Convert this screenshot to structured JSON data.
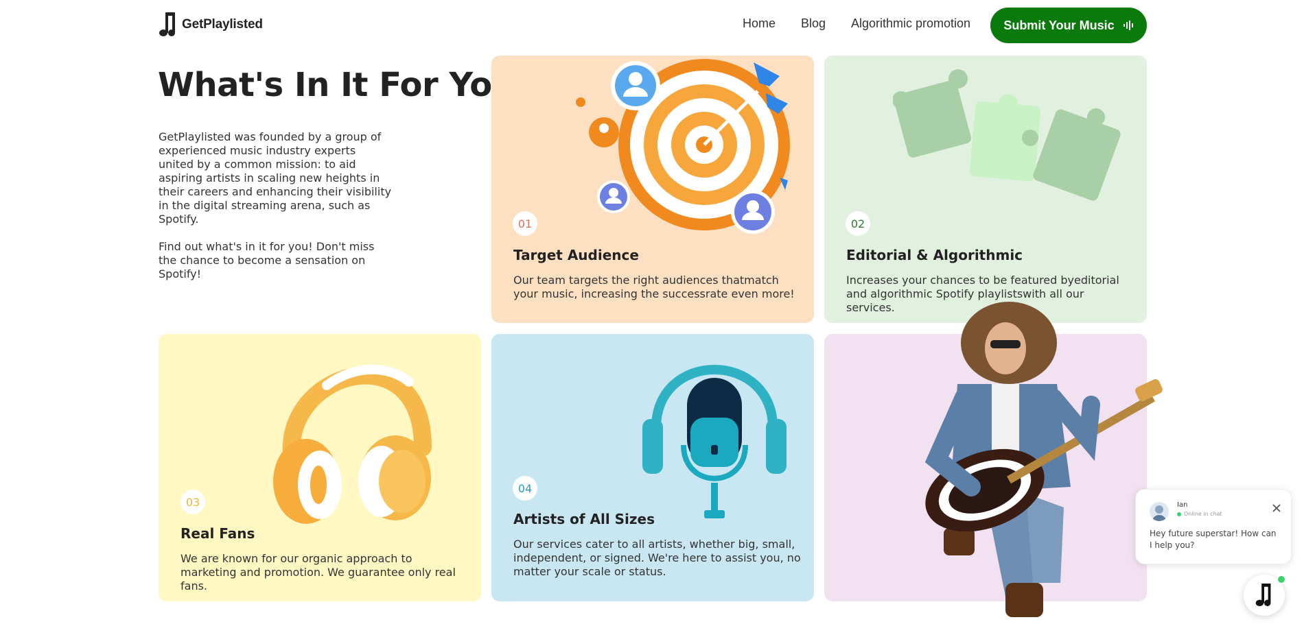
{
  "nav": {
    "logo_text": "GetPlaylisted",
    "links": [
      "Home",
      "Blog",
      "Algorithmic promotion"
    ],
    "cta_label": "Submit Your Music"
  },
  "intro": {
    "heading": "What's In It For You",
    "paragraph1": "GetPlaylisted was founded by a group of experienced music industry experts united by a common mission: to aid aspiring artists in scaling new heights in their careers and enhancing their visibility in the digital streaming arena, such as Spotify.",
    "paragraph2": "Find out what's in it for you! Don't miss the chance to become a sensation on Spotify!"
  },
  "cards": [
    {
      "number": "01",
      "title": "Target Audience",
      "text": "Our team targets the right audiences thatmatch your music, increasing the successrate even more!",
      "color": "#fde0c2",
      "number_color": "#d9725a"
    },
    {
      "number": "02",
      "title": "Editorial & Algorithmic",
      "text": "Increases your chances to be featured byeditorial and algorithmic Spotify playlistswith all our services.",
      "color": "#e2f0e0",
      "number_color": "#2e7d32"
    },
    {
      "number": "03",
      "title": "Real Fans",
      "text": "We are known for our organic approach to marketing and promotion. We guarantee only real fans.",
      "color": "#fff8c2",
      "number_color": "#e5b93a"
    },
    {
      "number": "04",
      "title": "Artists of All Sizes",
      "text": "Our services cater to all artists, whether big, small, independent, or signed. We're here to assist you, no matter your scale or status.",
      "color": "#c8e7f3",
      "number_color": "#2a9cc0"
    }
  ],
  "chat": {
    "agent_name": "Ian",
    "status": "Online in chat",
    "message": "Hey future superstar! How can I help you?"
  },
  "colors": {
    "brand_green": "#0a7a0c",
    "online_green": "#3bd16f"
  }
}
